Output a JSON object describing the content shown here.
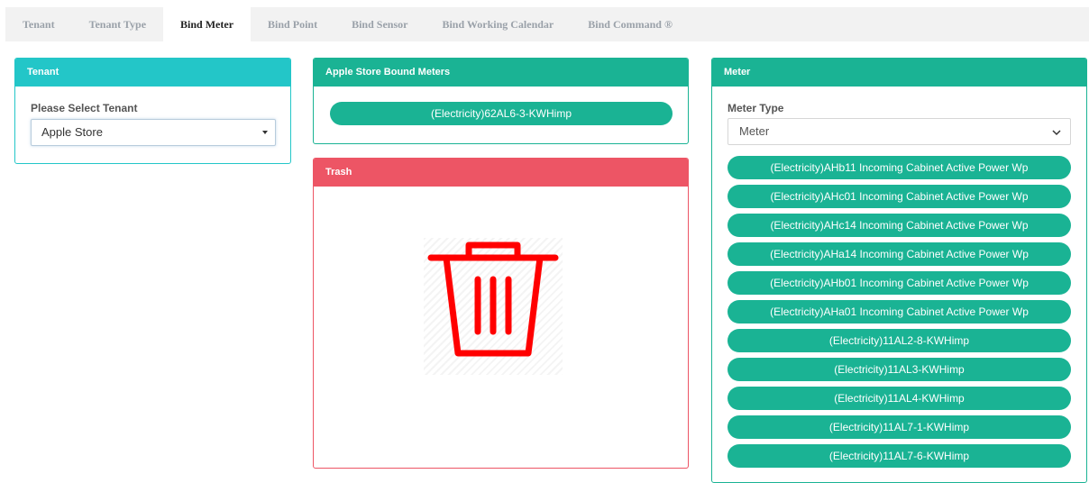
{
  "tabs": [
    {
      "label": "Tenant"
    },
    {
      "label": "Tenant Type"
    },
    {
      "label": "Bind Meter"
    },
    {
      "label": "Bind Point"
    },
    {
      "label": "Bind Sensor"
    },
    {
      "label": "Bind Working Calendar"
    },
    {
      "label": "Bind Command ®"
    }
  ],
  "tenant_panel": {
    "title": "Tenant",
    "field_label": "Please Select Tenant",
    "selected": "Apple Store"
  },
  "bound_panel": {
    "title": "Apple Store Bound Meters",
    "items": [
      "(Electricity)62AL6-3-KWHimp"
    ]
  },
  "trash_panel": {
    "title": "Trash",
    "icon": "trash-icon"
  },
  "meter_panel": {
    "title": "Meter",
    "type_label": "Meter Type",
    "type_selected": "Meter",
    "items": [
      "(Electricity)AHb11 Incoming Cabinet Active Power Wp",
      "(Electricity)AHc01 Incoming Cabinet Active Power Wp",
      "(Electricity)AHc14 Incoming Cabinet Active Power Wp",
      "(Electricity)AHa14 Incoming Cabinet Active Power Wp",
      "(Electricity)AHb01 Incoming Cabinet Active Power Wp",
      "(Electricity)AHa01 Incoming Cabinet Active Power Wp",
      "(Electricity)11AL2-8-KWHimp",
      "(Electricity)11AL3-KWHimp",
      "(Electricity)11AL4-KWHimp",
      "(Electricity)11AL7-1-KWHimp",
      "(Electricity)11AL7-6-KWHimp"
    ]
  },
  "colors": {
    "accent": "#1ab394",
    "tenant_header": "#23c6c8",
    "trash_header": "#ed5565",
    "trash_icon": "#ff0000"
  }
}
